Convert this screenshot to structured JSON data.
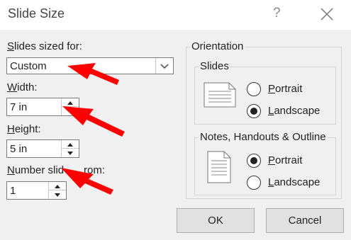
{
  "dialog": {
    "title": "Slide Size",
    "help_label": "?"
  },
  "slides_sized_for": {
    "label_accel": "S",
    "label_rest": "lides sized for:",
    "value": "Custom"
  },
  "width": {
    "label_accel": "W",
    "label_rest": "idth:",
    "value": "7 in"
  },
  "height": {
    "label_accel": "H",
    "label_rest": "eight:",
    "value": "5 in"
  },
  "number_slides_from": {
    "label_accel": "N",
    "label_visible": "umber slid",
    "label_tail": "rom:",
    "value": "1"
  },
  "orientation": {
    "group_label": "Orientation",
    "slides": {
      "group_label": "Slides",
      "portrait_accel": "P",
      "portrait_rest": "ortrait",
      "landscape_accel": "L",
      "landscape_rest": "andscape",
      "selected": "landscape"
    },
    "notes": {
      "group_label": "Notes, Handouts & Outline",
      "portrait_accel": "P",
      "portrait_rest": "ortrait",
      "landscape_accel": "L",
      "landscape_rest": "andscape",
      "selected": "portrait"
    }
  },
  "buttons": {
    "ok": "OK",
    "cancel": "Cancel"
  },
  "colors": {
    "annotation_arrow": "#ff0000",
    "dialog_background": "#f0f0f0",
    "titlebar_background": "#ffffff"
  }
}
